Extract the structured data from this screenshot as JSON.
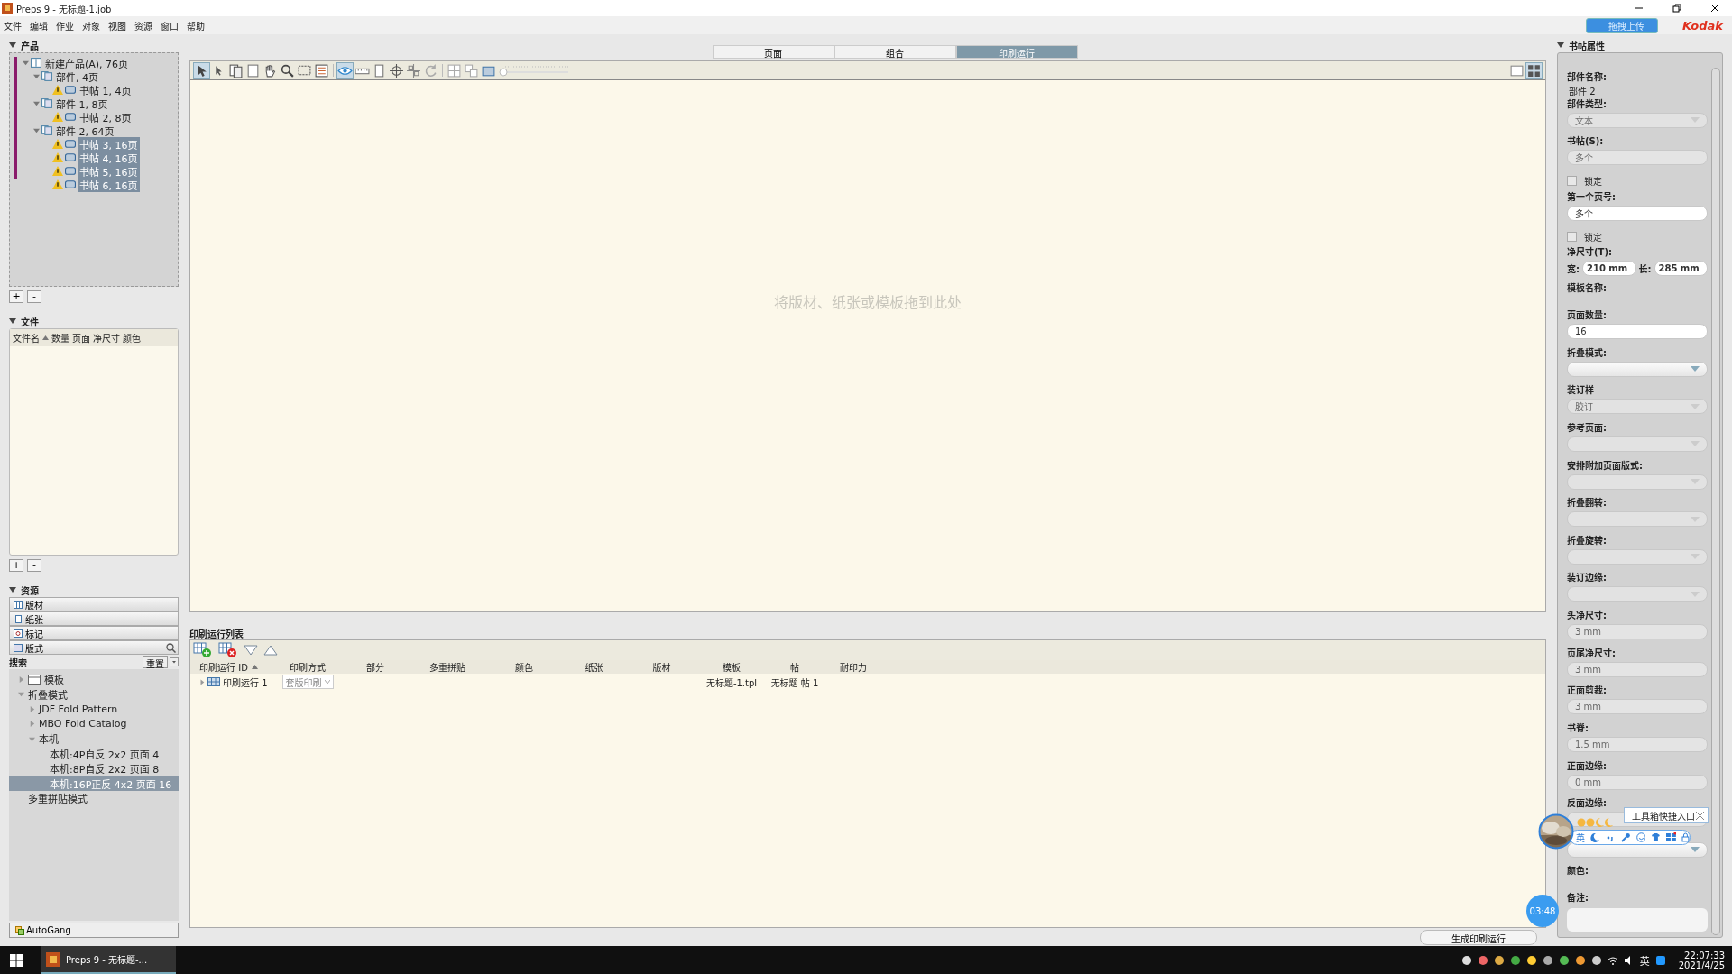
{
  "window": {
    "title": "Preps 9 - 无标题-1.job"
  },
  "menu": [
    "文件",
    "编辑",
    "作业",
    "对象",
    "视图",
    "资源",
    "窗口",
    "帮助"
  ],
  "top_right": {
    "upload_button": "拖拽上传",
    "logo": "Kodak"
  },
  "product_panel": {
    "title": "产品",
    "tree": [
      {
        "label": "新建产品(A), 76页",
        "kind": "product",
        "warning": false,
        "selected": false,
        "expanded": true,
        "children": [
          {
            "label": "部件, 4页",
            "kind": "part",
            "warning": false,
            "selected": false,
            "expanded": true,
            "children": [
              {
                "label": "书帖 1, 4页",
                "kind": "signature",
                "warning": true,
                "selected": false
              }
            ]
          },
          {
            "label": "部件 1, 8页",
            "kind": "part",
            "warning": false,
            "selected": false,
            "expanded": true,
            "children": [
              {
                "label": "书帖 2, 8页",
                "kind": "signature",
                "warning": true,
                "selected": false
              }
            ]
          },
          {
            "label": "部件 2, 64页",
            "kind": "part",
            "warning": false,
            "selected": false,
            "expanded": true,
            "children": [
              {
                "label": "书帖 3, 16页",
                "kind": "signature",
                "warning": true,
                "selected": true
              },
              {
                "label": "书帖 4, 16页",
                "kind": "signature",
                "warning": true,
                "selected": true
              },
              {
                "label": "书帖 5, 16页",
                "kind": "signature",
                "warning": true,
                "selected": true
              },
              {
                "label": "书帖 6, 16页",
                "kind": "signature",
                "warning": true,
                "selected": true
              }
            ]
          }
        ]
      }
    ],
    "add_button": "+",
    "remove_button": "-"
  },
  "files_panel": {
    "title": "文件",
    "columns": [
      "文件名",
      "数量",
      "页面",
      "净尺寸",
      "颜色"
    ],
    "add_button": "+",
    "remove_button": "-"
  },
  "resources_panel": {
    "title": "资源",
    "categories": [
      {
        "label": "版材",
        "kind": "plate"
      },
      {
        "label": "纸张",
        "kind": "paper"
      },
      {
        "label": "标记",
        "kind": "mark"
      },
      {
        "label": "版式",
        "kind": "layout"
      }
    ],
    "search_label": "搜索",
    "reset_button": "重置",
    "tree": [
      {
        "label": "模板",
        "kind": "folder",
        "selected": false,
        "expanded": false
      },
      {
        "label": "折叠模式",
        "kind": "category",
        "selected": false,
        "expanded": true,
        "children": [
          {
            "label": "JDF Fold Pattern",
            "selected": false,
            "expanded": false
          },
          {
            "label": "MBO Fold Catalog",
            "selected": false,
            "expanded": false
          },
          {
            "label": "本机",
            "selected": false,
            "expanded": true,
            "children": [
              {
                "label": "本机:4P自反 2x2 页面 4",
                "selected": false
              },
              {
                "label": "本机:8P自反 2x2 页面 8",
                "selected": false
              },
              {
                "label": "本机:16P正反 4x2 页面 16",
                "selected": true
              }
            ]
          }
        ]
      },
      {
        "label": "多重拼贴模式",
        "kind": "category",
        "selected": false
      }
    ]
  },
  "autogang_button": "AutoGang",
  "view_tabs": [
    {
      "label": "页面",
      "selected": false
    },
    {
      "label": "组合",
      "selected": false
    },
    {
      "label": "印刷运行",
      "selected": true
    }
  ],
  "zoom_slider": {
    "level": 0
  },
  "canvas": {
    "placeholder": "将版材、纸张或模板拖到此处"
  },
  "print_run_list": {
    "title": "印刷运行列表",
    "columns": [
      "印刷运行 ID",
      "印刷方式",
      "部分",
      "多重拼贴",
      "颜色",
      "纸张",
      "版材",
      "模板",
      "帖",
      "耐印力"
    ],
    "rows": [
      {
        "id": "印刷运行 1",
        "method": "套版印刷",
        "template": "无标题-1.tpl",
        "signature": "无标题 帖 1",
        "expanded": false
      }
    ]
  },
  "generate_button": "生成印刷运行",
  "properties": {
    "title": "书帖属性",
    "fields": [
      {
        "kind": "static",
        "label": "部件名称:",
        "value": "部件 2"
      },
      {
        "kind": "dropdown",
        "label": "部件类型:",
        "value": "文本",
        "disabled": true
      },
      {
        "kind": "text",
        "label": "书帖(S):",
        "value": "多个",
        "disabled": true
      },
      {
        "kind": "checkbox",
        "label": "锁定",
        "checked": false
      },
      {
        "kind": "text",
        "label": "第一个页号:",
        "value": "多个",
        "disabled": false
      },
      {
        "kind": "checkbox",
        "label": "锁定",
        "checked": false
      },
      {
        "kind": "size",
        "label": "净尺寸(T):",
        "width_label": "宽:",
        "width": "210 mm",
        "length_label": "长:",
        "length": "285 mm"
      },
      {
        "kind": "static",
        "label": "模板名称:"
      },
      {
        "kind": "text",
        "label": "页面数量:",
        "value": "16",
        "disabled": false
      },
      {
        "kind": "dropdown",
        "label": "折叠模式:",
        "disabled": false
      },
      {
        "kind": "dropdown",
        "label": "装订样",
        "value": "胶订",
        "disabled": true
      },
      {
        "kind": "dropdown",
        "label": "参考页面:",
        "disabled": true
      },
      {
        "kind": "dropdown",
        "label": "安排附加页面版式:",
        "disabled": true
      },
      {
        "kind": "dropdown",
        "label": "折叠翻转:",
        "disabled": true
      },
      {
        "kind": "dropdown",
        "label": "折叠旋转:",
        "disabled": true
      },
      {
        "kind": "dropdown",
        "label": "装订边缘:",
        "disabled": true
      },
      {
        "kind": "text",
        "label": "头净尺寸:",
        "value": "3 mm",
        "disabled": true
      },
      {
        "kind": "text",
        "label": "页尾净尺寸:",
        "value": "3 mm",
        "disabled": true
      },
      {
        "kind": "text",
        "label": "正面剪裁:",
        "value": "3 mm",
        "disabled": true
      },
      {
        "kind": "text",
        "label": "书脊:",
        "value": "1.5 mm",
        "disabled": true
      },
      {
        "kind": "text",
        "label": "正面边缘:",
        "value": "0 mm",
        "disabled": true
      },
      {
        "kind": "text",
        "label": "反面边缘:",
        "disabled": true
      },
      {
        "kind": "dropdown",
        "disabled": false
      },
      {
        "kind": "static",
        "label": "颜色:"
      },
      {
        "kind": "textarea",
        "label": "备注:"
      }
    ]
  },
  "ime_toolbar": {
    "tooltip": "工具箱快捷入口",
    "language": "英"
  },
  "timer": "03:48",
  "taskbar": {
    "app": "Preps 9 - 无标题-...",
    "language": "英",
    "time": "22:07:33",
    "date": "2021/4/25"
  }
}
